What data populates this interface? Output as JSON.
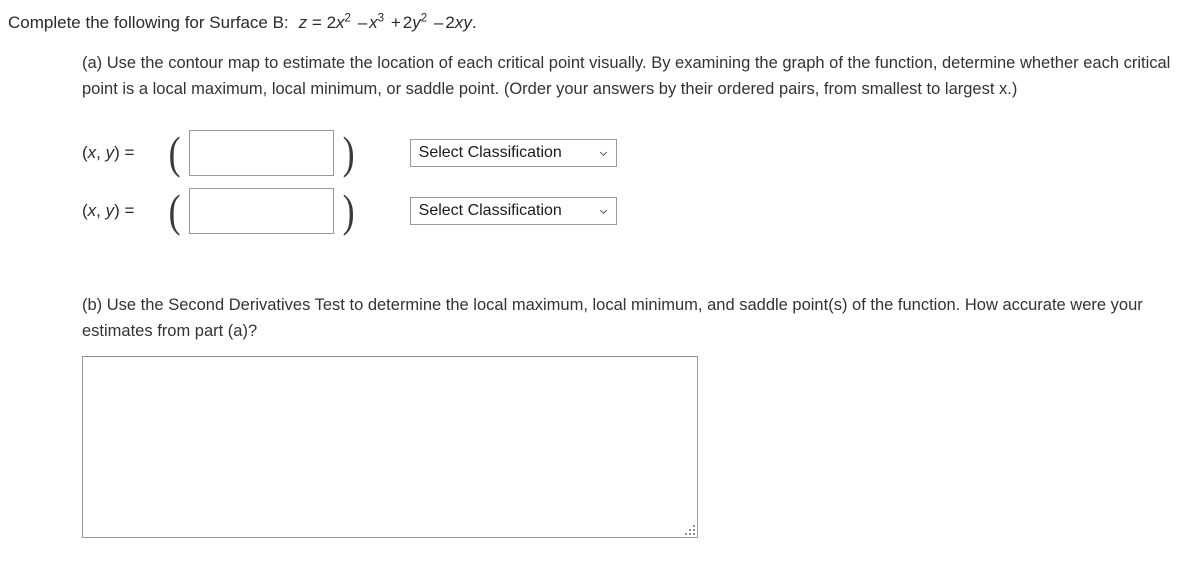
{
  "prompt": {
    "lead": "Complete the following for Surface B:",
    "equation": {
      "lhs": "z",
      "equals": "=",
      "terms": [
        {
          "sign": "",
          "coef": "2",
          "var": "x",
          "exp": "2"
        },
        {
          "sign": "–",
          "coef": "",
          "var": "x",
          "exp": "3"
        },
        {
          "sign": "+",
          "coef": "2",
          "var": "y",
          "exp": "2"
        },
        {
          "sign": "–",
          "coef": "2",
          "var": "xy",
          "exp": ""
        }
      ],
      "period": ".",
      "plain": "z = 2x2 - x3 + 2y2 - 2xy."
    }
  },
  "part_a": {
    "text": "(a) Use the contour map to estimate the location of each critical point visually. By examining the graph of the function, determine whether each critical point is a local maximum, local minimum, or saddle point. (Order your answers by their ordered pairs, from smallest to largest x.)",
    "rows": [
      {
        "label_prefix": "(",
        "label_x": "x",
        "label_sep": ", ",
        "label_y": "y",
        "label_suffix": ") =",
        "open_paren": "(",
        "close_paren": ")",
        "input_value": "",
        "input_placeholder": "",
        "select_label": "Select Classification",
        "select_icon": "chevron-down-icon"
      },
      {
        "label_prefix": "(",
        "label_x": "x",
        "label_sep": ", ",
        "label_y": "y",
        "label_suffix": ") =",
        "open_paren": "(",
        "close_paren": ")",
        "input_value": "",
        "input_placeholder": "",
        "select_label": "Select Classification",
        "select_icon": "chevron-down-icon"
      }
    ]
  },
  "part_b": {
    "text": "(b) Use the Second Derivatives Test to determine the local maximum, local minimum, and saddle point(s) of the function. How accurate were your estimates from part (a)?",
    "answer_value": "",
    "answer_placeholder": "",
    "resize_grip_icon": "resize-handle-icon"
  },
  "colors": {
    "text": "#333333",
    "border": "#9a9a9a",
    "background": "#ffffff"
  }
}
